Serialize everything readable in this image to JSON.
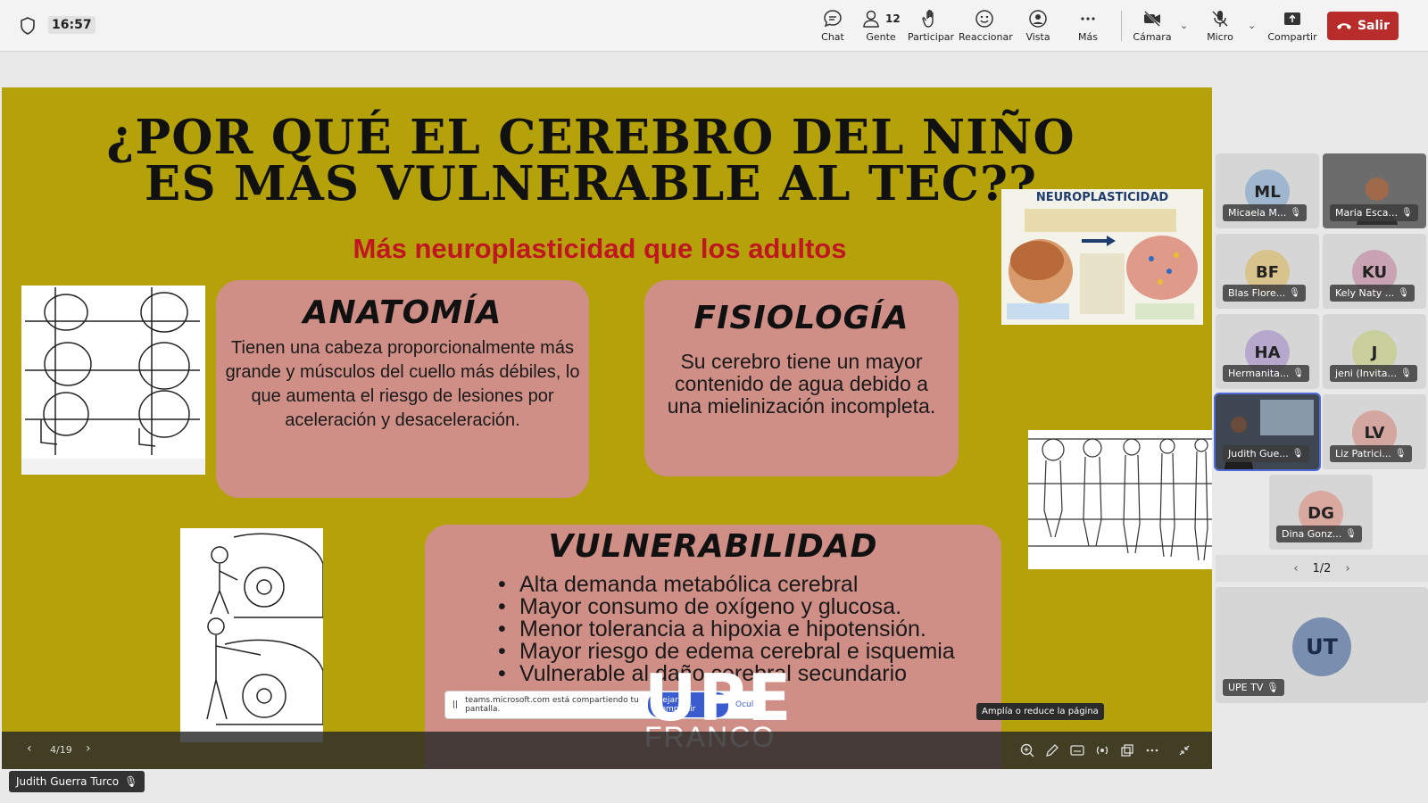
{
  "meeting": {
    "time": "16:57",
    "people_count": "12",
    "toolbar": {
      "chat": "Chat",
      "people": "Gente",
      "raise": "Participar",
      "react": "Reaccionar",
      "view": "Vista",
      "more": "Más",
      "camera": "Cámara",
      "mic": "Micro",
      "share": "Compartir",
      "leave": "Salir"
    }
  },
  "slide": {
    "title_line1": "¿POR QUÉ EL CEREBRO DEL NIÑO",
    "title_line2": "ES MÁS VULNERABLE AL TEC??",
    "subtitle": "Más neuroplasticidad que los adultos",
    "anatomy": {
      "heading": "ANATOMÍA",
      "text": "Tienen una cabeza proporcionalmente más grande y músculos del cuello más débiles, lo que aumenta el riesgo de lesiones por aceleración y desaceleración."
    },
    "physiology": {
      "heading": "FISIOLOGÍA",
      "text": "Su cerebro tiene un mayor contenido de agua debido a una mielinización incompleta."
    },
    "vulnerability": {
      "heading": "VULNERABILIDAD",
      "items": [
        "Alta demanda metabólica cerebral",
        "Mayor consumo de oxígeno y glucosa.",
        "Menor tolerancia a hipoxia e hipotensión.",
        "Mayor riesgo de edema cerebral e isquemia",
        "Vulnerable al daño cerebral secundario"
      ]
    },
    "neuro_title": "NEUROPLASTICIDAD"
  },
  "share_notice": {
    "text": "teams.microsoft.com está compartiendo tu pantalla.",
    "stop": "Dejar de compartir",
    "hide": "Ocultar"
  },
  "watermark": {
    "upe": "UPE",
    "franco": "FRANCO"
  },
  "tooltip": "Amplía o reduce la página",
  "viewer": {
    "page": "4/19"
  },
  "presenter_name": "Judith Guerra Turco",
  "participants": [
    {
      "initials": "ML",
      "name": "Micaela M...",
      "color": "#9fb6cf"
    },
    {
      "initials": "",
      "name": "Maria Esca...",
      "color": "#7a7a7a"
    },
    {
      "initials": "BF",
      "name": "Blas Flore...",
      "color": "#d9c38c"
    },
    {
      "initials": "KU",
      "name": "Kely Naty ...",
      "color": "#c9a3b2"
    },
    {
      "initials": "HA",
      "name": "Hermanita...",
      "color": "#b6a8cc"
    },
    {
      "initials": "J",
      "name": "jeni (Invita...",
      "color": "#c9cf9c"
    },
    {
      "initials": "",
      "name": "Judith Gue...",
      "color": "#4a4a4a"
    },
    {
      "initials": "LV",
      "name": "Liz Patrici...",
      "color": "#d4a6a0"
    },
    {
      "initials": "DG",
      "name": "Dina Gonz...",
      "color": "#d9a89f"
    }
  ],
  "pager": "1/2",
  "featured": {
    "initials": "UT",
    "name": "UPE TV"
  }
}
